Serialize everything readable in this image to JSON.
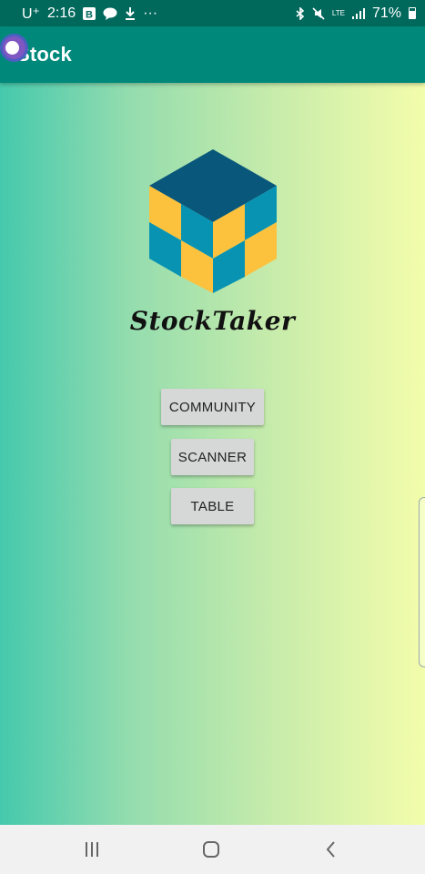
{
  "status_bar": {
    "carrier": "U⁺",
    "time": "2:16",
    "more": "···",
    "network": "LTE",
    "battery": "71%",
    "icons": [
      "b-icon",
      "message-icon",
      "download-icon",
      "bluetooth-icon",
      "mute-icon",
      "signal-icon",
      "battery-icon"
    ]
  },
  "app_bar": {
    "title": "Stock"
  },
  "main": {
    "brand_name": "StockTaker",
    "logo_colors": {
      "top": "#09577a",
      "yellow": "#fcc23e",
      "teal": "#0993b3"
    },
    "buttons": [
      {
        "label": "COMMUNITY"
      },
      {
        "label": "SCANNER"
      },
      {
        "label": "TABLE"
      }
    ]
  },
  "nav_bar": {
    "icons": [
      "recent-apps-icon",
      "home-icon",
      "back-icon"
    ]
  },
  "colors": {
    "status_bar": "#00695c",
    "app_bar": "#00897b",
    "gradient_start": "#45c9ad",
    "gradient_end": "#f3fdab",
    "button_bg": "#d6d7d7"
  }
}
